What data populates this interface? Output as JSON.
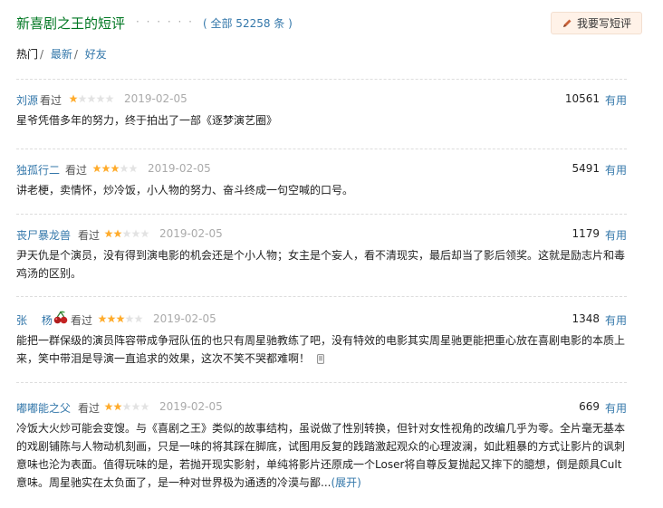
{
  "header": {
    "title": "新喜剧之王的短评",
    "dots": "· · · · · ·",
    "count": "( 全部 52258 条 )",
    "write_label": "我要写短评"
  },
  "tabs": {
    "hot": "热门",
    "latest": "最新",
    "friends": "好友",
    "sep": "/"
  },
  "colors": {
    "link": "#3377aa",
    "title_green": "#007722",
    "star_filled": "#ffac2d",
    "star_empty": "#e3e3e3"
  },
  "reviews": [
    {
      "author": "刘源",
      "watched": "看过",
      "rating": 1,
      "date": "2019-02-05",
      "votes": "10561",
      "useful": "有用",
      "text": "星爷凭借多年的努力，终于拍出了一部《逐梦演艺圈》"
    },
    {
      "author": "独孤行二",
      "watched": "看过",
      "rating": 3,
      "date": "2019-02-05",
      "votes": "5491",
      "useful": "有用",
      "text": "讲老梗，卖情怀，炒冷饭，小人物的努力、奋斗终成一句空喊的口号。"
    },
    {
      "author": "丧尸暴龙兽",
      "watched": "看过",
      "rating": 2,
      "date": "2019-02-05",
      "votes": "1179",
      "useful": "有用",
      "text": "尹天仇是个演员，没有得到演电影的机会还是个小人物；女主是个妄人，看不清现实，最后却当了影后领奖。这就是励志片和毒鸡汤的区别。"
    },
    {
      "author": "张　 杨",
      "badge_icon": "cherries-icon",
      "watched": "看过",
      "rating": 3,
      "date": "2019-02-05",
      "votes": "1348",
      "useful": "有用",
      "text": "能把一群保级的演员阵容带成争冠队伍的也只有周星驰教练了吧，没有特效的电影其实周星驰更能把重心放在喜剧电影的本质上来，笑中带泪是导演一直追求的效果，这次不笑不哭都难啊！",
      "trail_icon": "mobile-phone-icon"
    },
    {
      "author": "嘟嘟能之父",
      "watched": "看过",
      "rating": 2,
      "date": "2019-02-05",
      "votes": "669",
      "useful": "有用",
      "text": "冷饭大火炒可能会变馊。与《喜剧之王》类似的故事结构，虽说做了性别转换，但针对女性视角的改编几乎为零。全片毫无基本的戏剧铺陈与人物动机刻画，只是一味的将其踩在脚底，试图用反复的践踏激起观众的心理波澜，如此粗暴的方式让影片的讽刺意味也沦为表面。值得玩味的是，若抛开现实影射，单纯将影片还原成一个Loser将自尊反复抛起又摔下的臆想，倒是颇具Cult意味。周星驰实在太负面了，是一种对世界极为通透的冷漠与鄙...",
      "expand": "(展开)"
    }
  ]
}
